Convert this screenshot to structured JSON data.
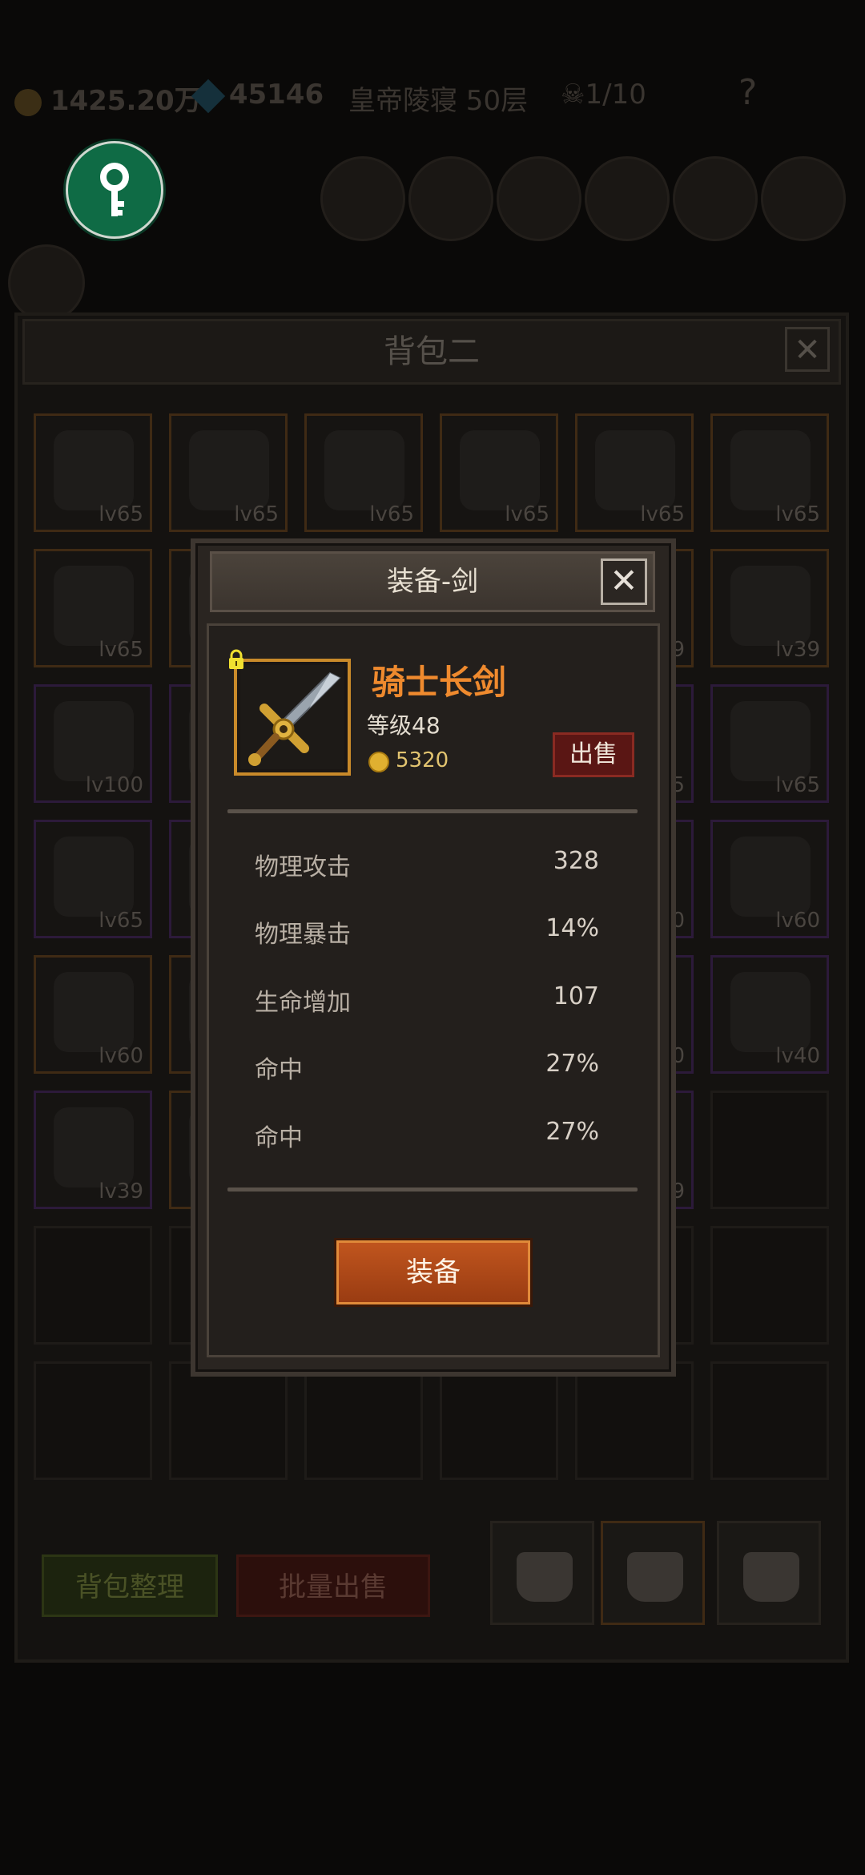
{
  "topbar": {
    "gold": "1425.20万",
    "gems": "45146",
    "floor": "皇帝陵寝 50层",
    "skull_count": "1/10",
    "help": "?"
  },
  "bag": {
    "title": "背包二",
    "close": "✕",
    "sort_label": "背包整理",
    "bulk_sell_label": "批量出售",
    "cells": [
      {
        "lv": "lv65",
        "rarity": "orange"
      },
      {
        "lv": "lv65",
        "rarity": "orange"
      },
      {
        "lv": "lv65",
        "rarity": "orange"
      },
      {
        "lv": "lv65",
        "rarity": "orange"
      },
      {
        "lv": "lv65",
        "rarity": "orange"
      },
      {
        "lv": "lv65",
        "rarity": "orange"
      },
      {
        "lv": "lv65",
        "rarity": "orange"
      },
      {
        "lv": "",
        "rarity": "orange"
      },
      {
        "lv": "",
        "rarity": "orange"
      },
      {
        "lv": "",
        "rarity": "orange"
      },
      {
        "lv": "9",
        "rarity": "orange"
      },
      {
        "lv": "lv39",
        "rarity": "orange"
      },
      {
        "lv": "lv100",
        "rarity": "purple"
      },
      {
        "lv": "",
        "rarity": "purple"
      },
      {
        "lv": "",
        "rarity": "purple"
      },
      {
        "lv": "",
        "rarity": "purple"
      },
      {
        "lv": "5",
        "rarity": "purple"
      },
      {
        "lv": "lv65",
        "rarity": "purple"
      },
      {
        "lv": "lv65",
        "rarity": "purple"
      },
      {
        "lv": "",
        "rarity": "purple"
      },
      {
        "lv": "",
        "rarity": "purple"
      },
      {
        "lv": "",
        "rarity": "purple"
      },
      {
        "lv": "0",
        "rarity": "purple"
      },
      {
        "lv": "lv60",
        "rarity": "purple"
      },
      {
        "lv": "lv60",
        "rarity": "orange"
      },
      {
        "lv": "",
        "rarity": "orange"
      },
      {
        "lv": "",
        "rarity": "orange"
      },
      {
        "lv": "",
        "rarity": "orange"
      },
      {
        "lv": "0",
        "rarity": "purple"
      },
      {
        "lv": "lv40",
        "rarity": "purple"
      },
      {
        "lv": "lv39",
        "rarity": "purple"
      },
      {
        "lv": "",
        "rarity": "orange"
      },
      {
        "lv": "",
        "rarity": "orange"
      },
      {
        "lv": "",
        "rarity": "orange"
      },
      {
        "lv": "9",
        "rarity": "purple"
      },
      {
        "lv": "",
        "rarity": "empty"
      },
      {
        "lv": "",
        "rarity": "empty"
      },
      {
        "lv": "",
        "rarity": "empty"
      },
      {
        "lv": "",
        "rarity": "empty"
      },
      {
        "lv": "",
        "rarity": "empty"
      },
      {
        "lv": "",
        "rarity": "empty"
      },
      {
        "lv": "",
        "rarity": "empty"
      },
      {
        "lv": "",
        "rarity": "empty"
      },
      {
        "lv": "",
        "rarity": "empty"
      },
      {
        "lv": "",
        "rarity": "empty"
      },
      {
        "lv": "",
        "rarity": "empty"
      },
      {
        "lv": "",
        "rarity": "empty"
      },
      {
        "lv": "",
        "rarity": "empty"
      }
    ]
  },
  "popup": {
    "title": "装备-剑",
    "close": "✕",
    "item_name": "骑士长剑",
    "item_level": "等级48",
    "price": "5320",
    "sell_label": "出售",
    "stats": [
      {
        "label": "物理攻击",
        "value": "328"
      },
      {
        "label": "物理暴击",
        "value": "14%"
      },
      {
        "label": "生命增加",
        "value": "107"
      },
      {
        "label": "命中",
        "value": "27%"
      },
      {
        "label": "命中",
        "value": "27%"
      }
    ],
    "equip_label": "装备"
  },
  "colors": {
    "item_name": "#ef8a2e",
    "equip_button": "#c0551e",
    "sell_button": "#5a1614",
    "key_button": "#0f6b45",
    "rare_orange_border": "#c98a2a"
  },
  "icons": [
    "key-icon",
    "lock-icon",
    "gold-coin-icon",
    "sword-icon",
    "close-icon",
    "backpack-icon",
    "gem-icon",
    "skull-icon",
    "help-icon"
  ]
}
